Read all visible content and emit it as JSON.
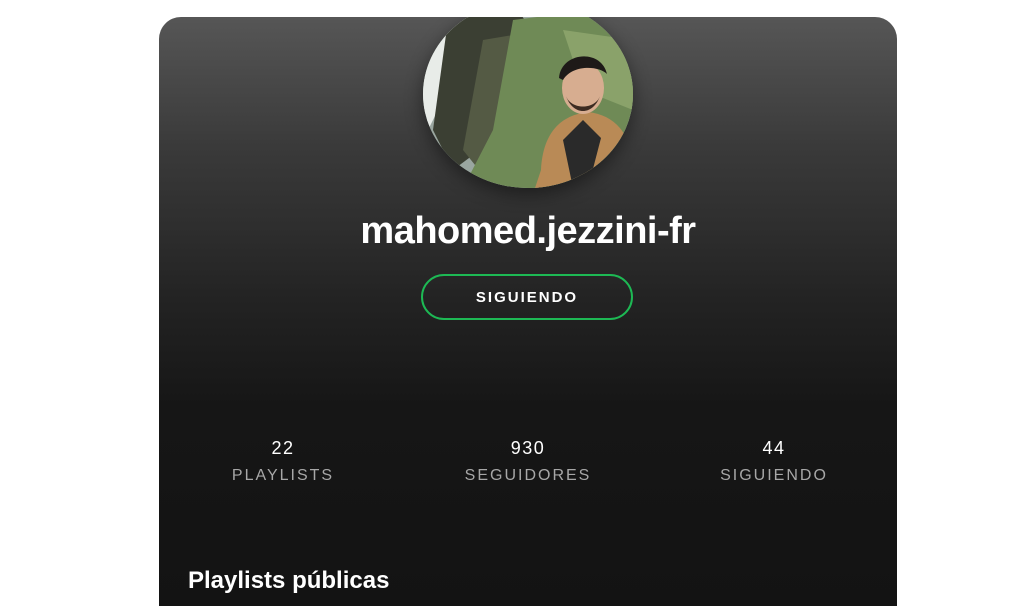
{
  "profile": {
    "username": "mahomed.jezzini-fr",
    "follow_button_label": "SIGUIENDO",
    "avatar_icon": "profile-photo"
  },
  "stats": [
    {
      "value": "22",
      "label": "PLAYLISTS"
    },
    {
      "value": "930",
      "label": "SEGUIDORES"
    },
    {
      "value": "44",
      "label": "SIGUIENDO"
    }
  ],
  "sections": {
    "public_playlists_title": "Playlists públicas"
  },
  "colors": {
    "accent": "#1db954",
    "background": "#131313",
    "text_primary": "#ffffff",
    "text_secondary": "#a7a7a7"
  }
}
